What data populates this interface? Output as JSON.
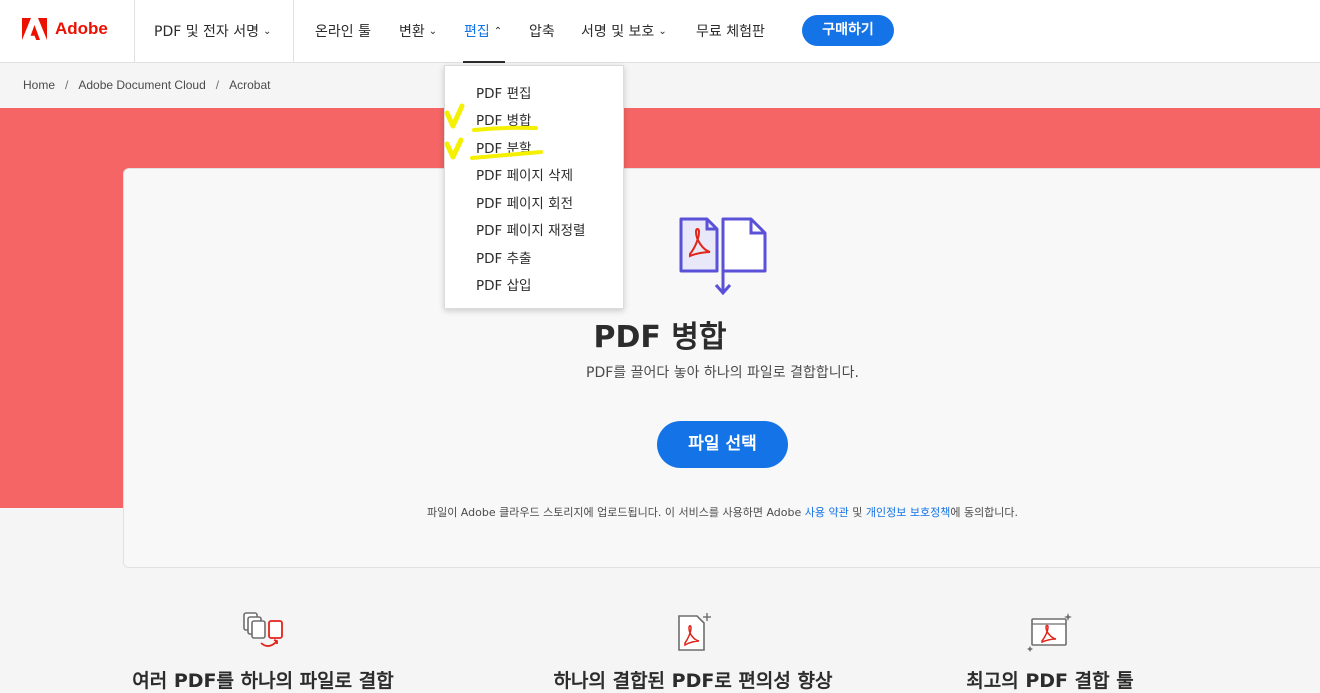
{
  "brand": {
    "name": "Adobe",
    "color": "#eb1000"
  },
  "nav": {
    "pdf_sign": "PDF 및 전자 서명",
    "online_tools": "온라인 툴",
    "convert": "변환",
    "edit": "편집",
    "compress": "압축",
    "sign_protect": "서명 및 보호",
    "free_trial": "무료 체험판",
    "buy": "구매하기"
  },
  "breadcrumb": [
    "Home",
    "Adobe Document Cloud",
    "Acrobat"
  ],
  "dropdown": {
    "items": [
      "PDF 편집",
      "PDF 병합",
      "PDF 분할",
      "PDF 페이지 삭제",
      "PDF 페이지 회전",
      "PDF 페이지 재정렬",
      "PDF 추출",
      "PDF 삽입"
    ],
    "highlighted": [
      "PDF 병합",
      "PDF 분할"
    ]
  },
  "hero": {
    "title": "PDF 병합",
    "subtitle": "PDF를 끌어다 놓아 하나의 파일로 결합합니다.",
    "button": "파일 선택",
    "legal_prefix": "파일이 Adobe 클라우드 스토리지에 업로드됩니다. 이 서비스를 사용하면 Adobe ",
    "legal_terms": "사용 약관",
    "legal_and": " 및 ",
    "legal_privacy": "개인정보 보호정책",
    "legal_suffix": "에 동의합니다."
  },
  "features": [
    {
      "title": "여러 PDF를 하나의 파일로 결합",
      "icon": "combine-files-icon"
    },
    {
      "title": "하나의 결합된 PDF로 편의성 향상",
      "icon": "pdf-add-icon"
    },
    {
      "title": "최고의 PDF 결합 툴",
      "icon": "pdf-sparkle-icon"
    }
  ],
  "colors": {
    "accent": "#1473e6",
    "hero_band": "#f56565",
    "highlight": "#f5f000"
  }
}
